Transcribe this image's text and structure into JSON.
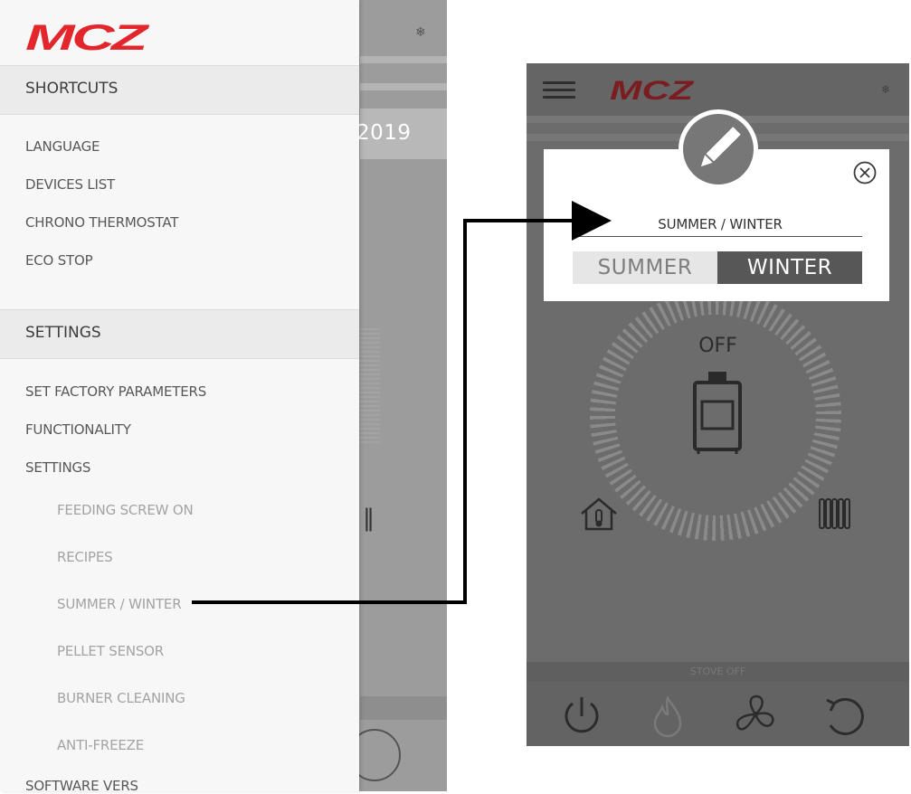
{
  "left_screen": {
    "brand": "MCZ",
    "background_date_fragment": "2019",
    "sections": [
      {
        "label": "SHORTCUTS",
        "items": [
          "LANGUAGE",
          "DEVICES LIST",
          "CHRONO THERMOSTAT",
          "ECO STOP"
        ]
      },
      {
        "label": "SETTINGS",
        "items": [
          "SET FACTORY PARAMETERS",
          "FUNCTIONALITY",
          "SETTINGS"
        ],
        "subitems": [
          "FEEDING SCREW ON",
          "RECIPES",
          "SUMMER / WINTER",
          "PELLET SENSOR",
          "BURNER CLEANING",
          "ANTI-FREEZE"
        ],
        "partial_item": "SOFTWARE VERS"
      }
    ],
    "icons": [
      "snowflake-icon",
      "radiator-icon",
      "power-button-icon"
    ]
  },
  "right_screen": {
    "brand": "MCZ",
    "dialog": {
      "title": "SUMMER / WINTER",
      "options": [
        "SUMMER",
        "WINTER"
      ],
      "selected": "WINTER",
      "icons": [
        "pencil-icon",
        "close-icon"
      ]
    },
    "status_label": "OFF",
    "footer_status": "STOVE OFF",
    "bottom_icons": [
      "power-icon",
      "flame-icon",
      "fan-icon",
      "refresh-icon"
    ],
    "side_icons": [
      "house-thermometer-icon",
      "radiator-icon"
    ]
  },
  "colors": {
    "brand_red": "#e3262b",
    "dialog_selected": "#575757",
    "dialog_unselected": "#e6e6e6",
    "overlay_gray": "#6c6c6c"
  }
}
